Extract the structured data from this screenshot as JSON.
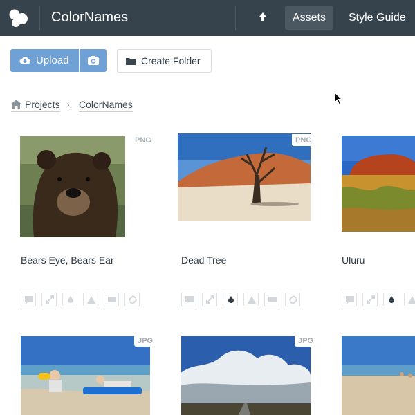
{
  "app": {
    "title": "ColorNames"
  },
  "nav": {
    "assets_label": "Assets",
    "style_guide_label": "Style Guide"
  },
  "toolbar": {
    "upload_label": "Upload",
    "create_folder_label": "Create Folder"
  },
  "breadcrumb": {
    "home_label": "Projects",
    "current_label": "ColorNames"
  },
  "assets": [
    {
      "title": "Bears Eye, Bears Ear",
      "format": "PNG"
    },
    {
      "title": "Dead Tree",
      "format": "PNG"
    },
    {
      "title": "Uluru",
      "format": ""
    },
    {
      "title": "",
      "format": "JPG"
    },
    {
      "title": "",
      "format": "JPG"
    },
    {
      "title": "",
      "format": ""
    }
  ],
  "card_tools": [
    "comment-icon",
    "resize-icon",
    "color-drop-icon",
    "warning-icon",
    "display-icon",
    "link-icon"
  ],
  "colors": {
    "topbar": "#37434c",
    "nav_active": "#4b5761",
    "primary": "#6fa1d6",
    "badge": "#a6aeb4",
    "tool_border": "#dfe3e6"
  }
}
